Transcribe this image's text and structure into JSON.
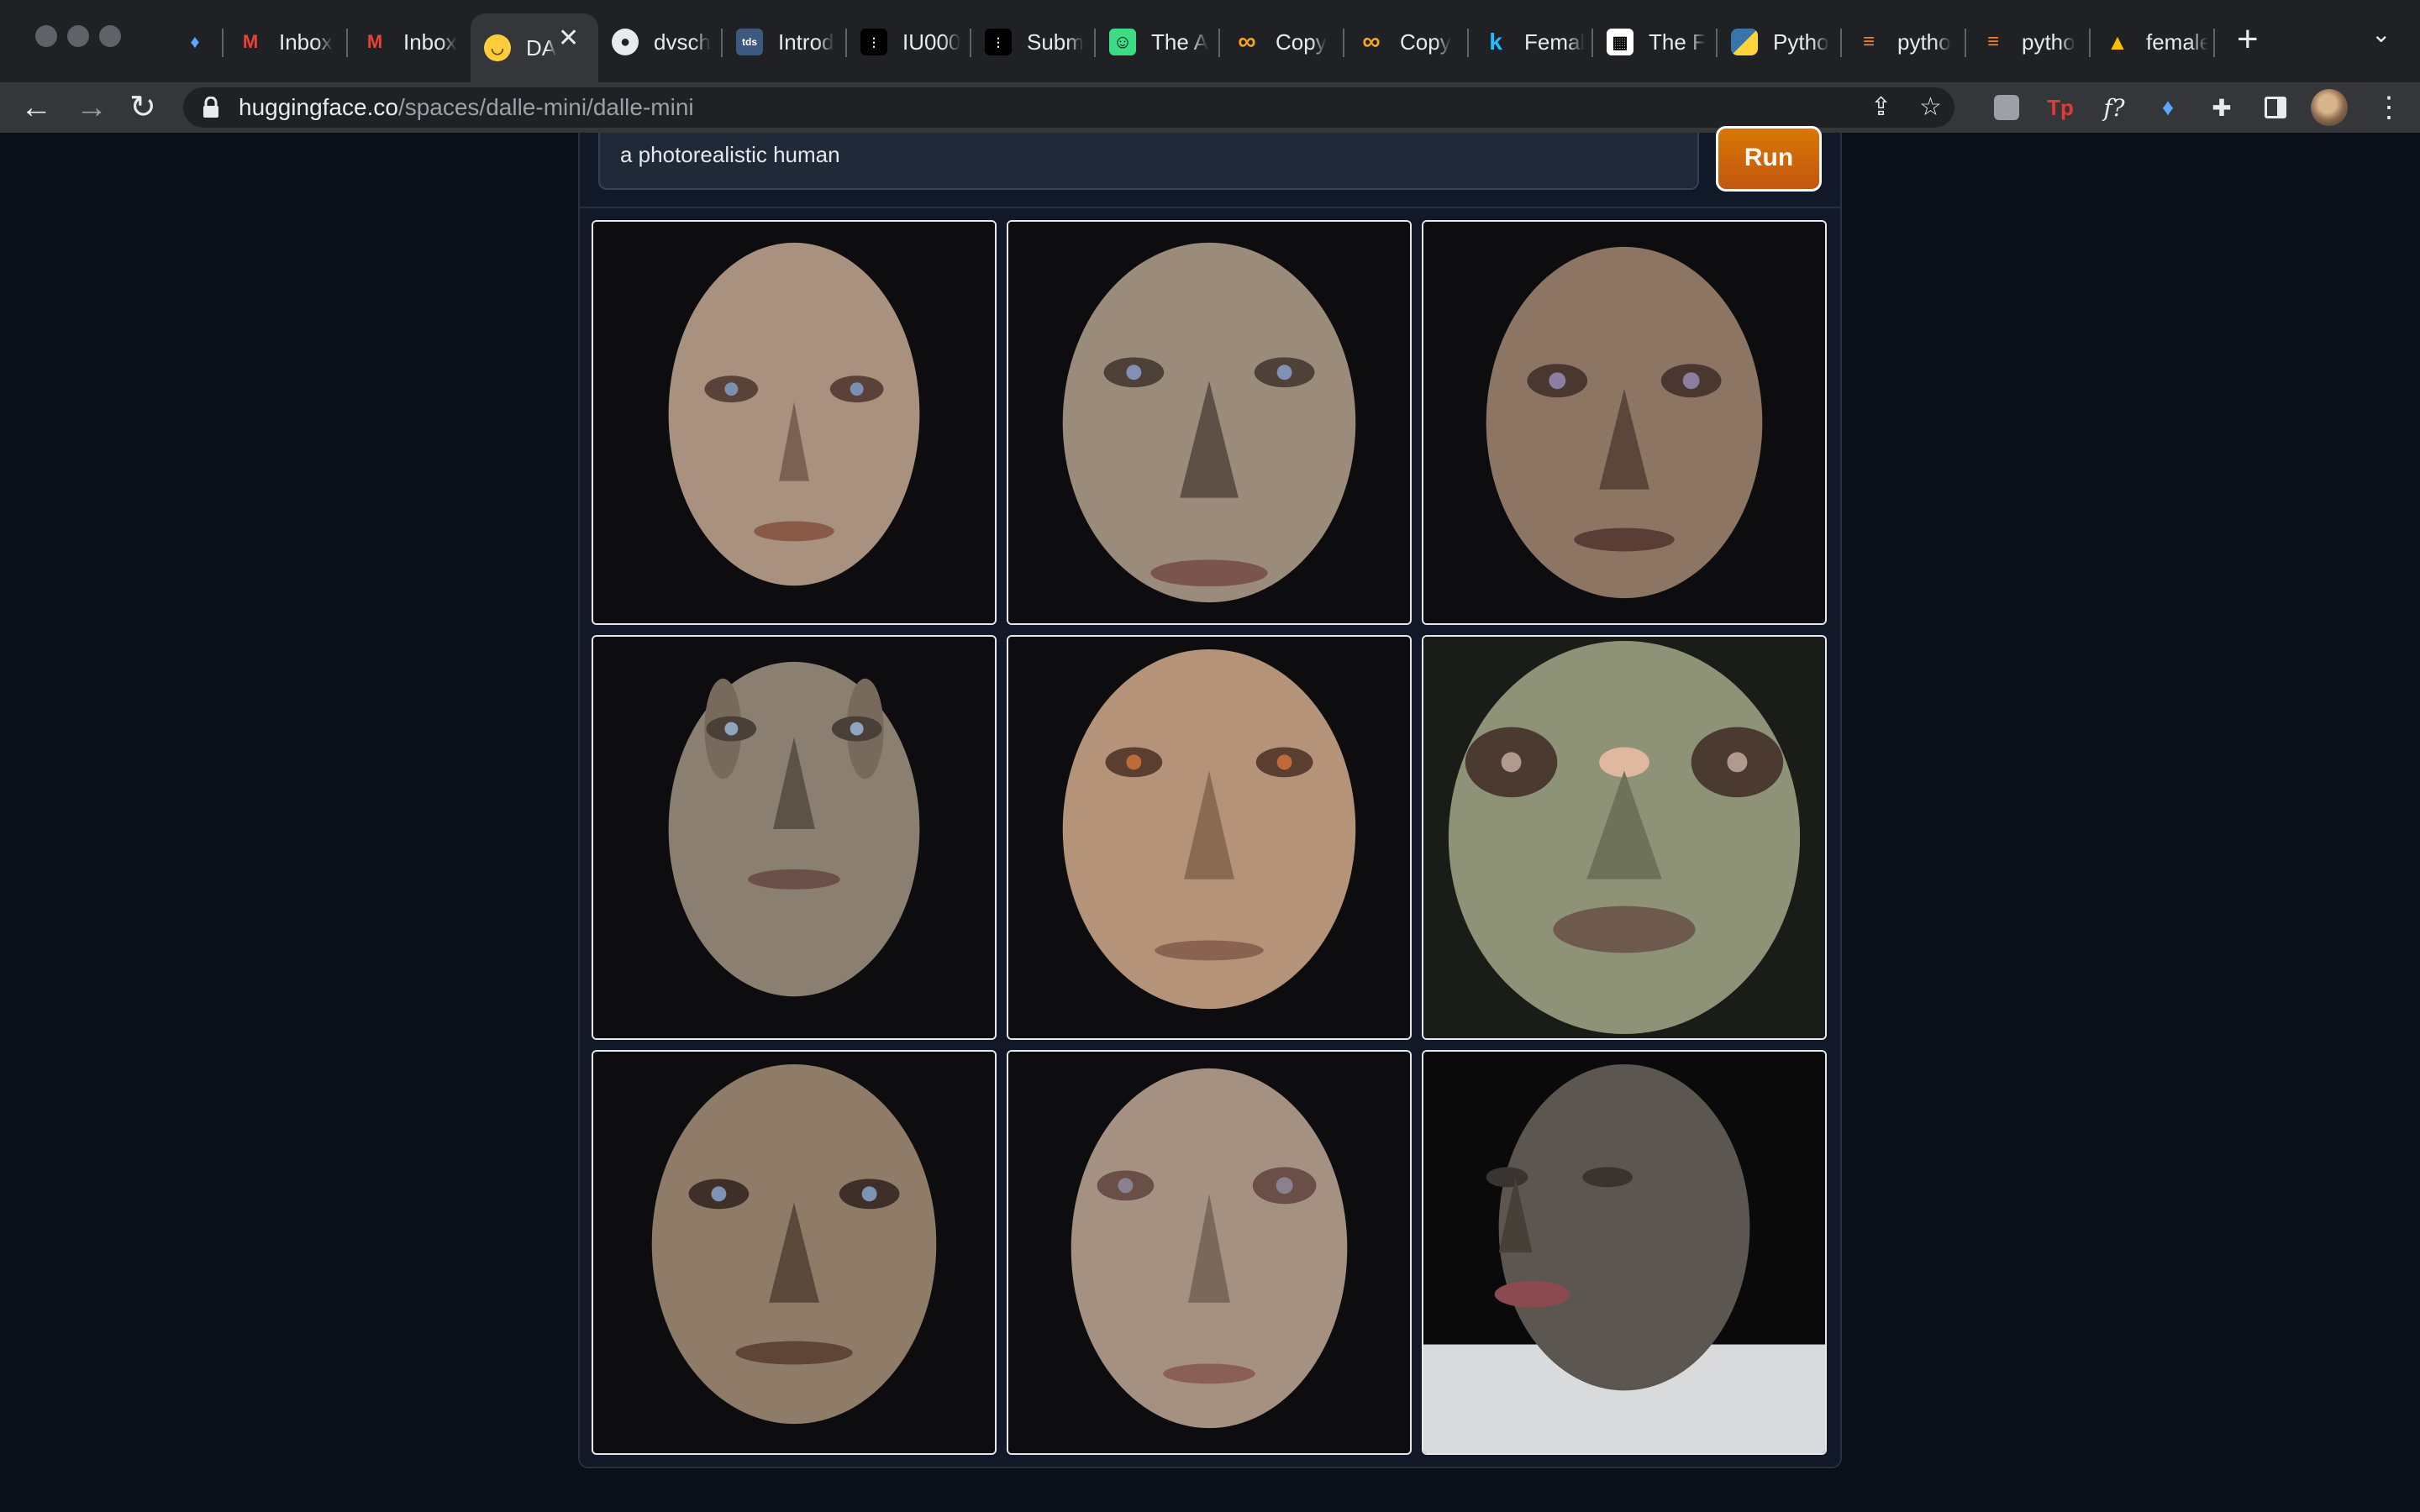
{
  "browser": {
    "tabs": [
      {
        "title": "",
        "icon": "gem-icon"
      },
      {
        "title": "Inbox",
        "icon": "gmail-icon"
      },
      {
        "title": "Inbox",
        "icon": "gmail-icon"
      },
      {
        "title": "DA",
        "icon": "huggingface-icon",
        "active": true
      },
      {
        "title": "dvsch",
        "icon": "github-icon"
      },
      {
        "title": "Introd",
        "icon": "tds-icon"
      },
      {
        "title": "IU000",
        "icon": "dots-icon"
      },
      {
        "title": "Subm",
        "icon": "dots-icon"
      },
      {
        "title": "The A",
        "icon": "smiley-icon"
      },
      {
        "title": "Copy",
        "icon": "infinity-icon"
      },
      {
        "title": "Copy",
        "icon": "infinity-icon"
      },
      {
        "title": "Femal",
        "icon": "k-icon"
      },
      {
        "title": "The F",
        "icon": "qr-icon"
      },
      {
        "title": "Pytho",
        "icon": "python-icon"
      },
      {
        "title": "pytho",
        "icon": "stackoverflow-icon"
      },
      {
        "title": "pytho",
        "icon": "stackoverflow-icon"
      },
      {
        "title": "female",
        "icon": "google-drive-icon"
      }
    ],
    "url_host": "huggingface.co",
    "url_path": "/spaces/dalle-mini/dalle-mini"
  },
  "app": {
    "prompt_value": "a photorealistic human",
    "run_label": "Run",
    "accent_color": "#c2570f",
    "images": [
      {
        "name": "gallery-image-1",
        "skin": "#a8927f"
      },
      {
        "name": "gallery-image-2",
        "skin": "#9b8b7b"
      },
      {
        "name": "gallery-image-3",
        "skin": "#8c7563"
      },
      {
        "name": "gallery-image-4",
        "skin": "#8a7f70"
      },
      {
        "name": "gallery-image-5",
        "skin": "#b49378"
      },
      {
        "name": "gallery-image-6",
        "skin": "#8e9378"
      },
      {
        "name": "gallery-image-7",
        "skin": "#8e7b68"
      },
      {
        "name": "gallery-image-8",
        "skin": "#a59182"
      },
      {
        "name": "gallery-image-9",
        "skin": "#5c5650"
      }
    ]
  }
}
